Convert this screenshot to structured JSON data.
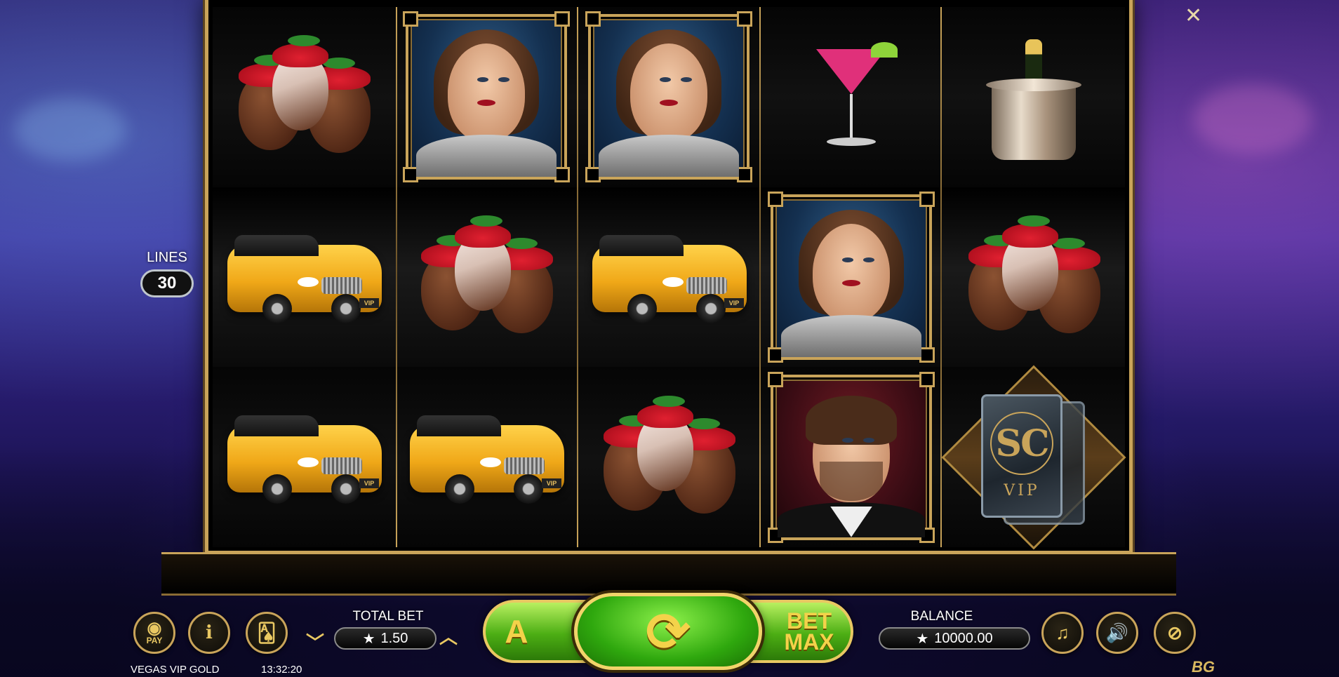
{
  "game": {
    "title": "VEGAS VIP GOLD",
    "clock": "13:32:20",
    "close_icon": "close-icon",
    "provider_logo": "BG"
  },
  "lines": {
    "label": "LINES",
    "value": "30"
  },
  "reels": [
    [
      "strawberries",
      "limo",
      "limo"
    ],
    [
      "woman",
      "strawberries",
      "limo"
    ],
    [
      "woman",
      "limo",
      "strawberries"
    ],
    [
      "martini",
      "woman",
      "man"
    ],
    [
      "champagne",
      "strawberries",
      "scatter"
    ]
  ],
  "scatter": {
    "letters": "SC",
    "tag": "VIP"
  },
  "limo_plate": "VIP",
  "bottom_bar": {
    "pay_label": "PAY",
    "info_icon": "i",
    "total_bet_label": "TOTAL BET",
    "total_bet_value": "1.50",
    "balance_label": "BALANCE",
    "balance_value": "10000.00",
    "currency_symbol": "★",
    "auto_label": "A",
    "bet_max_line1": "BET",
    "bet_max_line2": "MAX"
  },
  "colors": {
    "gold": "#c9a45a",
    "spin_green": "#2fa80e",
    "background": "#2a1a6e"
  }
}
